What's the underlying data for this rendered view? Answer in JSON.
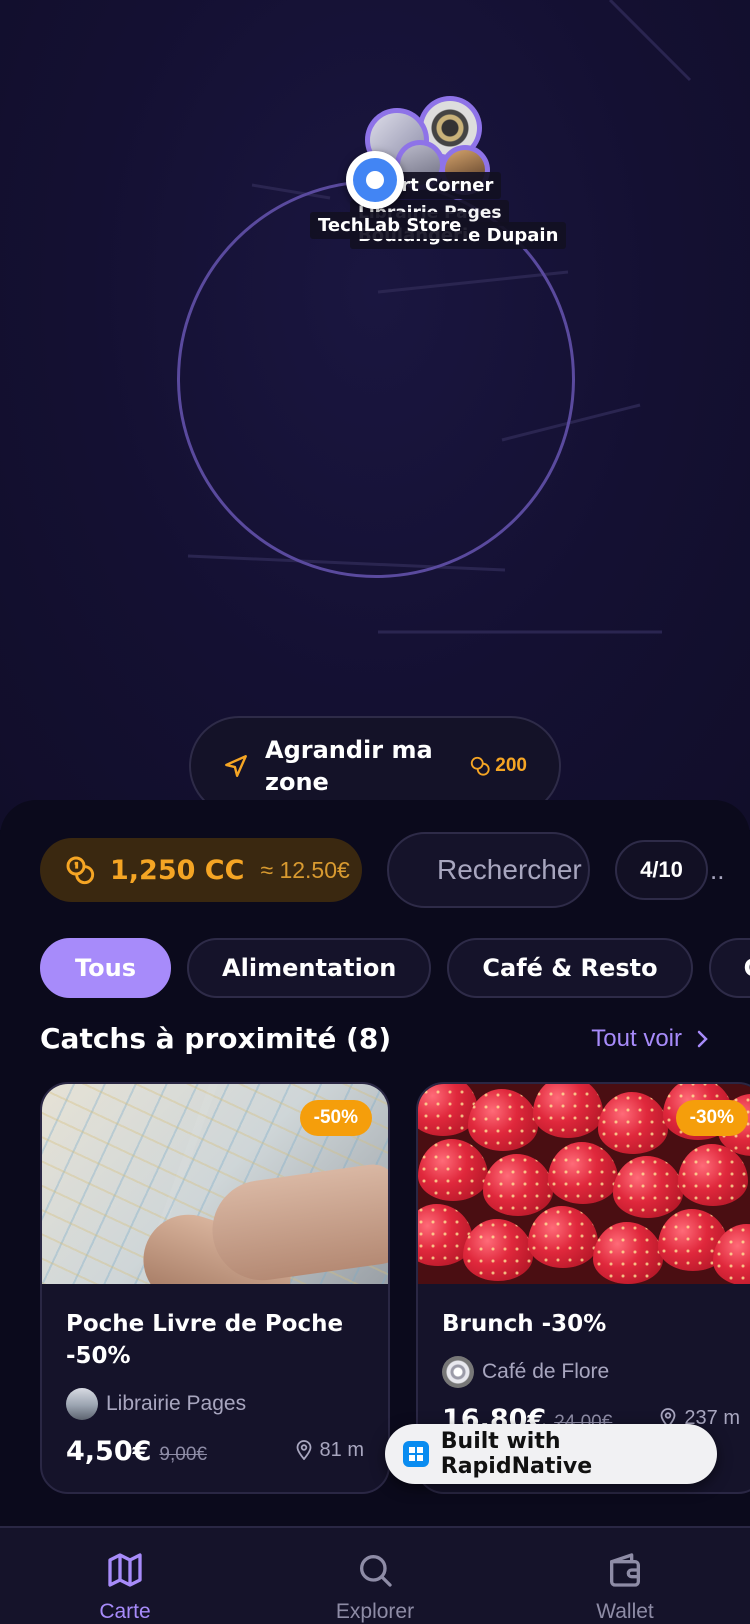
{
  "map": {
    "labels": {
      "sport": "Sport Corner",
      "pages": "Librairie Pages",
      "boulangerie": "Boulangerie Dupain",
      "techlab": "TechLab Store"
    },
    "expand_zone": {
      "label": "Agrandir ma zone",
      "cost": "200",
      "icon": "navigation-arrow-icon",
      "cost_icon": "coins-icon"
    }
  },
  "wallet": {
    "balance": "1,250 CC",
    "euro_equiv": "≈ 12.50€",
    "icon": "coins-icon"
  },
  "search": {
    "placeholder": "Rechercher un...",
    "value": ""
  },
  "counter": "4/10",
  "categories": [
    "Tous",
    "Alimentation",
    "Café & Resto",
    "Culture"
  ],
  "active_category": "Tous",
  "section": {
    "title": "Catchs à proximité (8)",
    "see_all": "Tout voir"
  },
  "offers": [
    {
      "discount": "-50%",
      "title": "Poche Livre de Poche -50%",
      "shop": "Librairie Pages",
      "price": "4,50€",
      "old_price": "9,00€",
      "distance": "81 m"
    },
    {
      "discount": "-30%",
      "title": "Brunch -30%",
      "shop": "Café de Flore",
      "price": "16,80€",
      "old_price": "24,00€",
      "distance": "237 m"
    }
  ],
  "built_with": "Built with RapidNative",
  "tabs": [
    {
      "label": "Carte",
      "icon": "map-icon",
      "active": true
    },
    {
      "label": "Explorer",
      "icon": "search-icon",
      "active": false
    },
    {
      "label": "Wallet",
      "icon": "wallet-icon",
      "active": false
    }
  ],
  "colors": {
    "accent": "#a78bfa",
    "coin": "#f5a524",
    "background": "#0b0a1c",
    "user_location": "#4285f4"
  }
}
